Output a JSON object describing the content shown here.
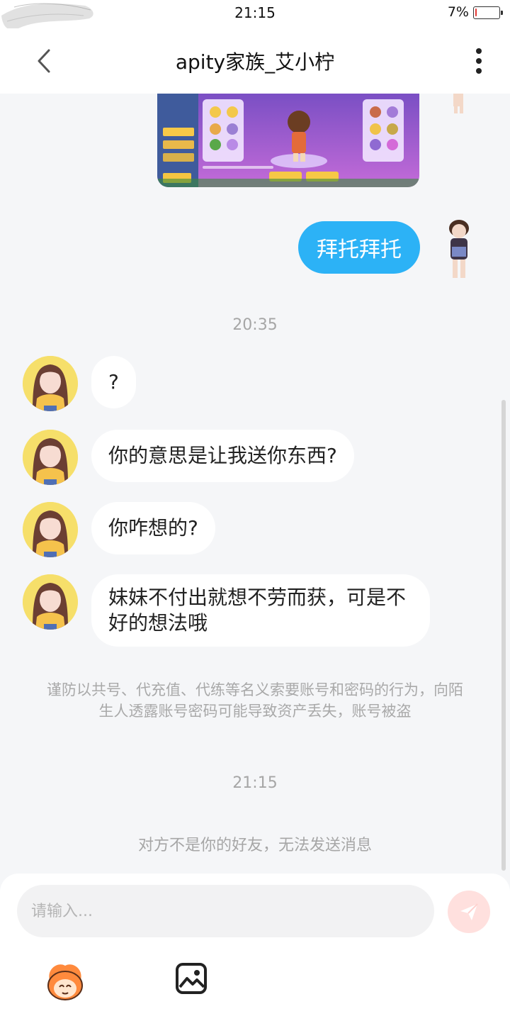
{
  "status_bar": {
    "time": "21:15",
    "battery_text": "7%",
    "battery_level": 0.07
  },
  "header": {
    "title": "apity家族_艾小柠",
    "back_icon": "chevron-left-icon",
    "more_icon": "more-vertical-icon"
  },
  "chat": {
    "outgoing_message": "拜托拜托",
    "timestamp_1": "20:35",
    "incoming_messages": [
      {
        "text": "?"
      },
      {
        "text": "你的意思是让我送你东西?"
      },
      {
        "text": "你咋想的?"
      },
      {
        "text": "妹妹不付出就想不劳而获，可是不好的想法哦"
      }
    ],
    "notice": "谨防以共号、代充值、代练等名义索要账号和密码的行为，向陌生人透露账号密码可能导致资产丢失，账号被盗",
    "timestamp_2": "21:15",
    "system_message": "对方不是你的好友，无法发送消息"
  },
  "composer": {
    "input_placeholder": "请输入...",
    "send_icon": "paper-plane-icon",
    "emoji_icon": "mascot-emoji-icon",
    "image_icon": "image-icon"
  },
  "colors": {
    "accent": "#2cb2f6",
    "send_disabled": "#ffe0de",
    "battery_low": "#e53935"
  }
}
